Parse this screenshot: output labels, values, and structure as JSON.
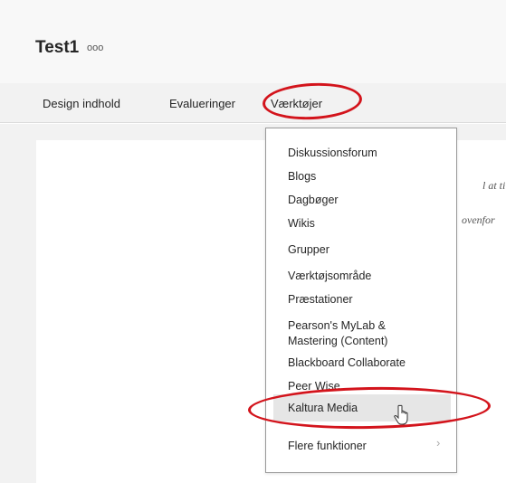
{
  "page": {
    "title": "Test1",
    "more_icon": "ooo"
  },
  "tabs": [
    {
      "label": "Design indhold"
    },
    {
      "label": "Evalueringer"
    },
    {
      "label": "Værktøjer"
    }
  ],
  "content": {
    "hint_line_1": "l at tilføj",
    "hint_line_2": "ovenfor"
  },
  "dropdown": {
    "items": [
      {
        "label": "Diskussionsforum"
      },
      {
        "label": "Blogs"
      },
      {
        "label": "Dagbøger"
      },
      {
        "label": "Wikis"
      },
      {
        "label": "Grupper"
      },
      {
        "label": "Værktøjsområde"
      },
      {
        "label": "Præstationer"
      },
      {
        "label": "Pearson's MyLab &"
      },
      {
        "label": "Mastering (Content)"
      },
      {
        "label": "Blackboard Collaborate"
      },
      {
        "label": "Peer Wise"
      },
      {
        "label": "Kaltura Media"
      },
      {
        "label": "Flere funktioner"
      }
    ],
    "submenu_chevron": "›"
  },
  "icons": {
    "cursor": "hand-pointer-icon",
    "more": "more-icon",
    "chevron": "chevron-right-icon"
  },
  "colors": {
    "annotation": "#d3141c",
    "hover": "#e6e6e6"
  }
}
